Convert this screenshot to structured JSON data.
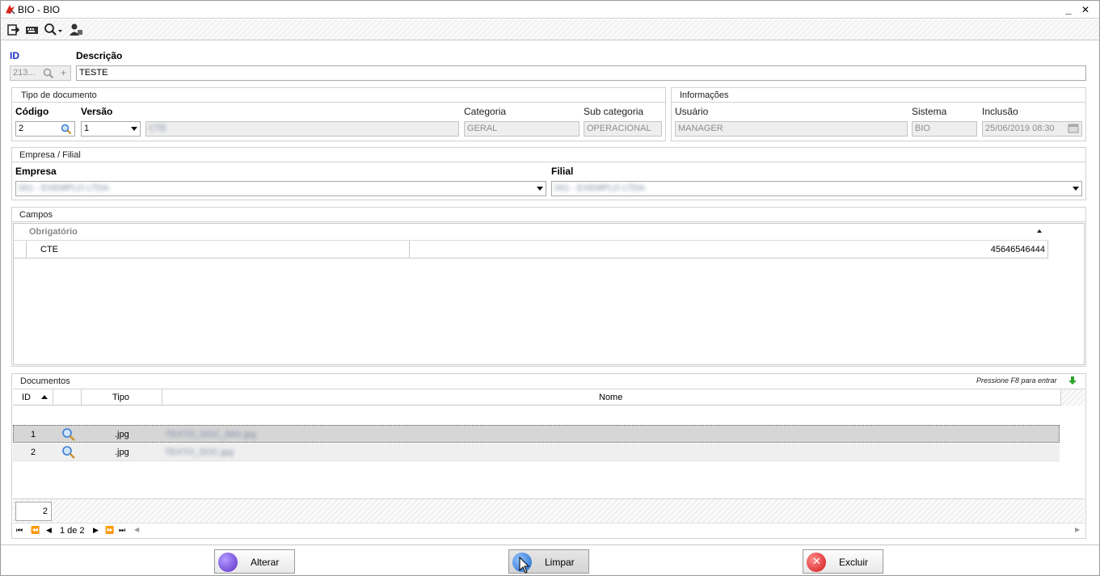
{
  "window": {
    "title": "BIO - BIO",
    "minimize": "_",
    "close": "✕"
  },
  "toolbar": {
    "icons": [
      "exit-icon",
      "keyboard-icon",
      "search-dropdown-icon",
      "user-icon"
    ]
  },
  "header": {
    "id_label": "ID",
    "id_value": "213...",
    "description_label": "Descrição",
    "description_value": "TESTE"
  },
  "tipo_documento": {
    "title": "Tipo de documento",
    "codigo_label": "Código",
    "codigo_value": "2",
    "versao_label": "Versão",
    "versao_value": "1",
    "nome_value": "CTE",
    "categoria_label": "Categoria",
    "categoria_value": "GERAL",
    "subcategoria_label": "Sub categoria",
    "subcategoria_value": "OPERACIONAL"
  },
  "informacoes": {
    "title": "Informações",
    "usuario_label": "Usuário",
    "usuario_value": "MANAGER",
    "sistema_label": "Sistema",
    "sistema_value": "BIO",
    "inclusao_label": "Inclusão",
    "inclusao_value": "25/06/2019 08:30"
  },
  "empresa_filial": {
    "title": "Empresa / Filial",
    "empresa_label": "Empresa",
    "empresa_value": "001 - EXEMPLO LTDA",
    "filial_label": "Filial",
    "filial_value": "001 - EXEMPLO LTDA"
  },
  "campos": {
    "title": "Campos",
    "group_header": "Obrigatório",
    "rows": [
      {
        "name": "CTE",
        "value": "45646546444"
      }
    ]
  },
  "documentos": {
    "title": "Documentos",
    "hint": "Pressione F8 para entrar",
    "columns": {
      "id": "ID",
      "tipo": "Tipo",
      "nome": "Nome"
    },
    "rows": [
      {
        "id": "1",
        "tipo": ".jpg",
        "nome": "TEXTO_DOC_IMG.jpg"
      },
      {
        "id": "2",
        "tipo": ".jpg",
        "nome": "TEXTO_DOC.jpg"
      }
    ],
    "count": "2",
    "pager": "1 de 2"
  },
  "buttons": {
    "alterar": "Alterar",
    "limpar": "Limpar",
    "excluir": "Excluir"
  },
  "colors": {
    "accent_blue": "#1b2fc7",
    "selected_row": "#d6d6d6",
    "green_arrow": "#2aa52a"
  }
}
